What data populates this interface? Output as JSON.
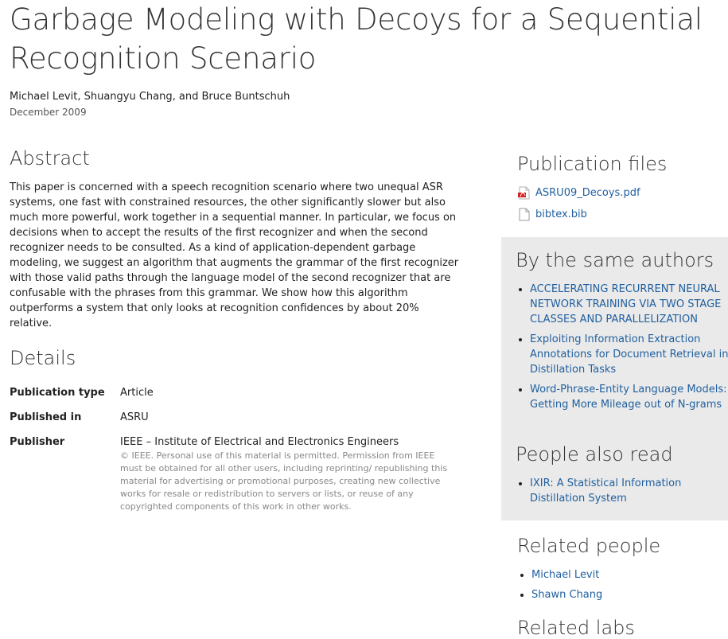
{
  "page": {
    "title": "Garbage Modeling with Decoys for a Sequential Recognition Scenario",
    "authors": "Michael Levit, Shuangyu Chang, and Bruce Buntschuh",
    "date": "December 2009"
  },
  "abstract": {
    "heading": "Abstract",
    "text": "This paper is concerned with a speech recognition scenario where two unequal ASR systems, one fast with constrained resources, the other significantly slower but also much more powerful, work together in a sequential manner. In particular, we focus on decisions when to accept the results of the first recognizer and when the second recognizer needs to be consulted. As a kind of application-dependent garbage modeling, we suggest an algorithm that augments the grammar of the first recognizer with those valid paths through the language model of the second recognizer that are confusable with the phrases from this grammar. We show how this algorithm outperforms a system that only looks at recognition confidences by about 20% relative."
  },
  "details": {
    "heading": "Details",
    "rows": [
      {
        "label": "Publication type",
        "value": "Article"
      },
      {
        "label": "Published in",
        "value": "ASRU"
      },
      {
        "label": "Publisher",
        "value": "IEEE – Institute of Electrical and Electronics Engineers"
      }
    ],
    "copyright": "© IEEE. Personal use of this material is permitted. Permission from IEEE must be obtained for all other users, including reprinting/ republishing this material for advertising or promotional purposes, creating new collective works for resale or redistribution to servers or lists, or reuse of any copyrighted components of this work in other works."
  },
  "publication_files": {
    "heading": "Publication files",
    "files": [
      {
        "name": "ASRU09_Decoys.pdf",
        "icon": "pdf-icon"
      },
      {
        "name": "bibtex.bib",
        "icon": "file-icon"
      }
    ]
  },
  "same_authors": {
    "heading": "By the same authors",
    "items": [
      "ACCELERATING RECURRENT NEURAL NETWORK TRAINING VIA TWO STAGE CLASSES AND PARALLELIZATION",
      "Exploiting Information Extraction Annotations for Document Retrieval in Distillation Tasks",
      "Word-Phrase-Entity Language Models: Getting More Mileage out of N-grams"
    ]
  },
  "also_read": {
    "heading": "People also read",
    "items": [
      "IXIR: A Statistical Information Distillation System"
    ]
  },
  "related_people": {
    "heading": "Related people",
    "items": [
      "Michael Levit",
      "Shawn Chang"
    ]
  },
  "related_labs": {
    "heading": "Related labs"
  },
  "colors": {
    "link": "#1f5f9f",
    "side_panel": "#eaeaea"
  }
}
